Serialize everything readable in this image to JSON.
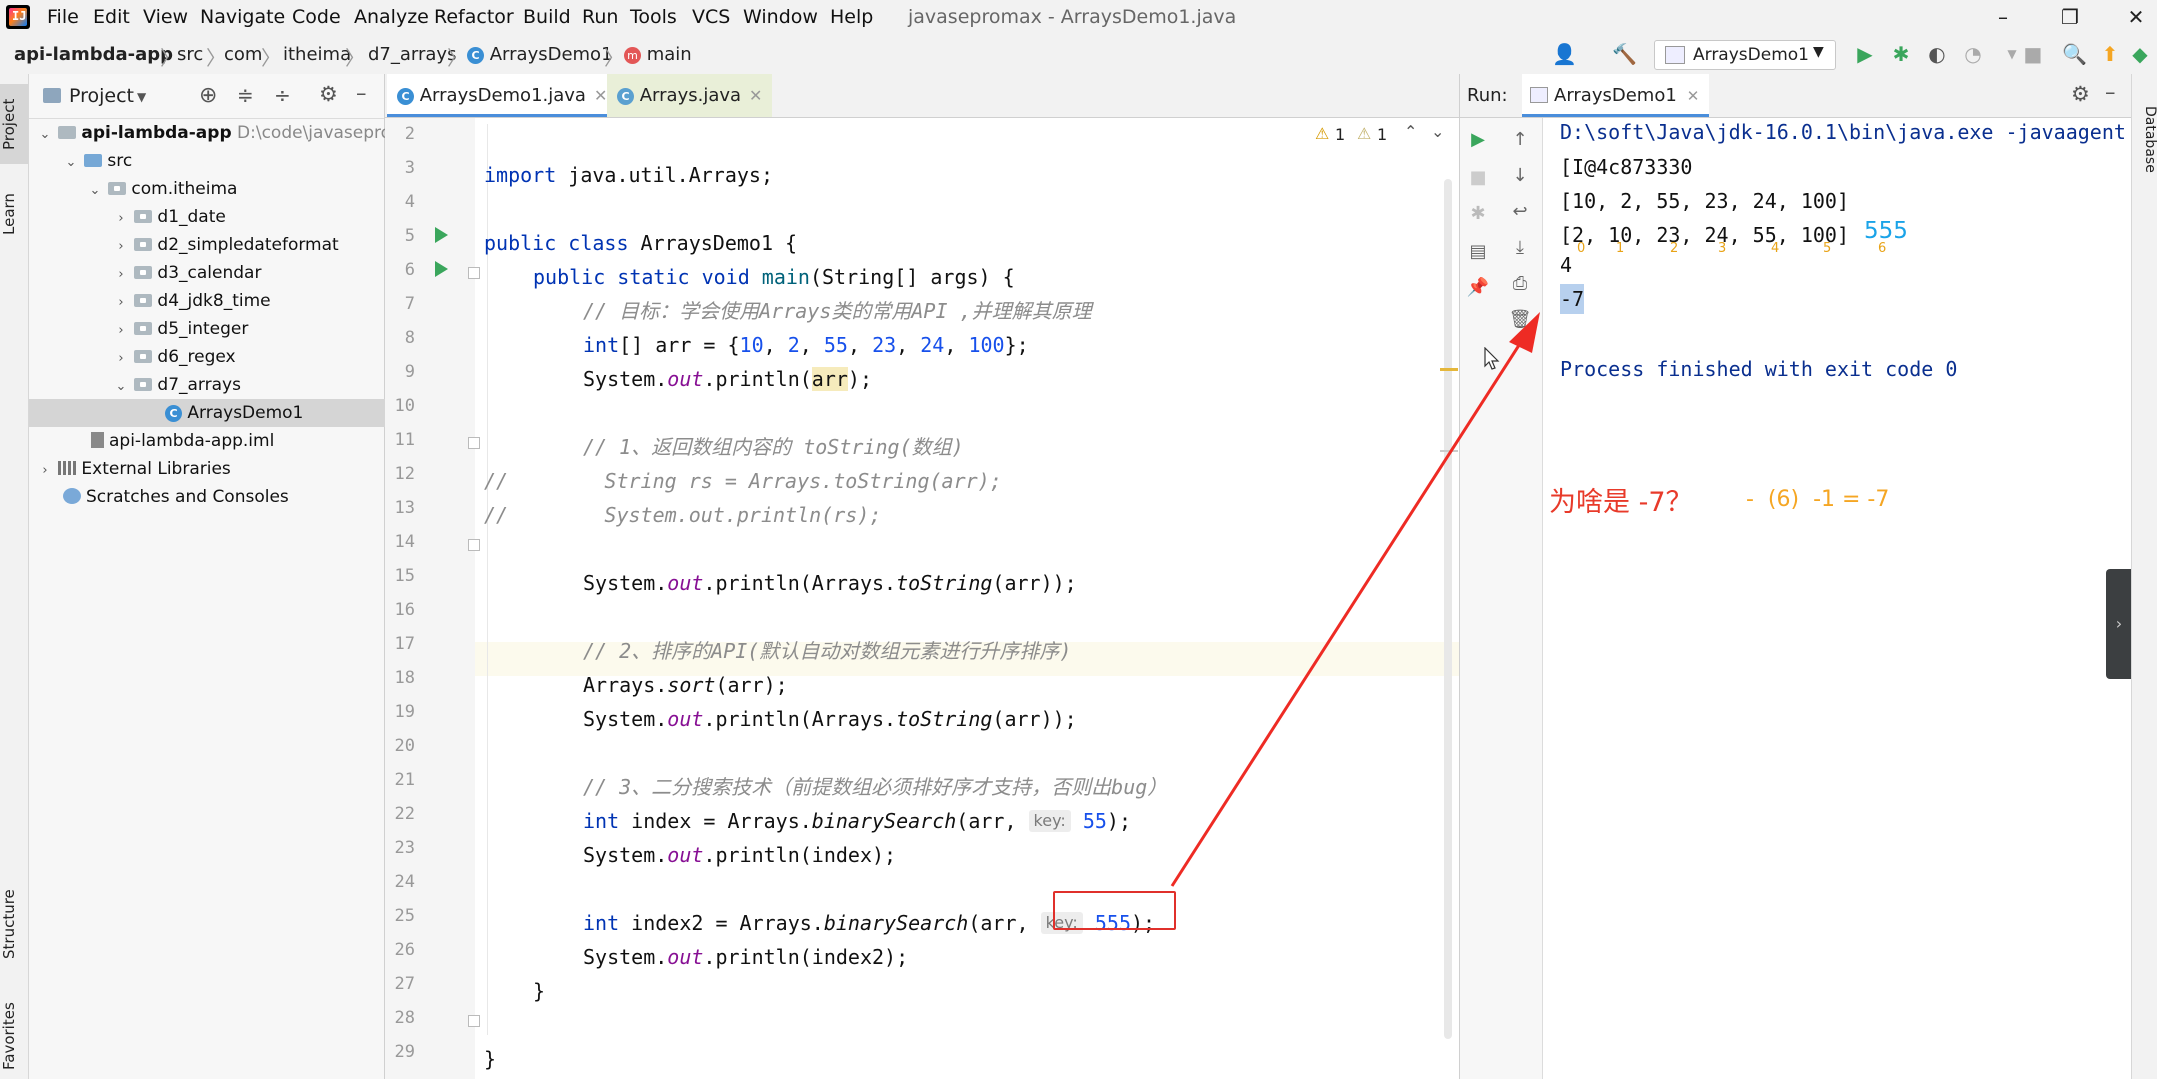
{
  "menubar": {
    "items": [
      "File",
      "Edit",
      "View",
      "Navigate",
      "Code",
      "Analyze",
      "Refactor",
      "Build",
      "Run",
      "Tools",
      "VCS",
      "Window",
      "Help"
    ],
    "window_title": "javasepromax - ArraysDemo1.java"
  },
  "navbar": {
    "breadcrumbs": [
      "api-lambda-app",
      "src",
      "com",
      "itheima",
      "d7_arrays",
      "ArraysDemo1",
      "main"
    ],
    "run_config": "ArraysDemo1"
  },
  "left_strip": {
    "tabs": [
      "Project",
      "Learn",
      "Structure",
      "Favorites"
    ]
  },
  "right_strip": {
    "tabs": [
      "Database"
    ]
  },
  "project": {
    "title": "Project",
    "tree": [
      {
        "label": "api-lambda-app",
        "extra": "D:\\code\\javasepro",
        "kind": "module",
        "arrow": "v"
      },
      {
        "label": "src",
        "kind": "folder-blue",
        "arrow": "v"
      },
      {
        "label": "com.itheima",
        "kind": "package",
        "arrow": "v"
      },
      {
        "label": "d1_date",
        "kind": "package",
        "arrow": ">"
      },
      {
        "label": "d2_simpledateformat",
        "kind": "package",
        "arrow": ">"
      },
      {
        "label": "d3_calendar",
        "kind": "package",
        "arrow": ">"
      },
      {
        "label": "d4_jdk8_time",
        "kind": "package",
        "arrow": ">"
      },
      {
        "label": "d5_integer",
        "kind": "package",
        "arrow": ">"
      },
      {
        "label": "d6_regex",
        "kind": "package",
        "arrow": ">"
      },
      {
        "label": "d7_arrays",
        "kind": "package",
        "arrow": "v"
      },
      {
        "label": "ArraysDemo1",
        "kind": "class",
        "arrow": ""
      },
      {
        "label": "api-lambda-app.iml",
        "kind": "iml",
        "arrow": ""
      },
      {
        "label": "External Libraries",
        "kind": "lib",
        "arrow": ">"
      },
      {
        "label": "Scratches and Consoles",
        "kind": "scratch",
        "arrow": ""
      }
    ]
  },
  "editor": {
    "tabs": [
      {
        "label": "ArraysDemo1.java",
        "active": true
      },
      {
        "label": "Arrays.java",
        "active": false
      }
    ],
    "warnings": [
      "1",
      "1"
    ],
    "line_numbers": [
      "2",
      "3",
      "4",
      "5",
      "6",
      "7",
      "8",
      "9",
      "10",
      "11",
      "12",
      "13",
      "14",
      "15",
      "16",
      "17",
      "18",
      "19",
      "20",
      "21",
      "22",
      "23",
      "24",
      "25",
      "26",
      "27",
      "28",
      "29"
    ],
    "code": {
      "l3_kw": "import",
      "l3_rest": " java.util.Arrays;",
      "l5_kw": "public class",
      "l5_rest": " ArraysDemo1 {",
      "l6_kw": "public static void",
      "l6_fn": "main",
      "l6_rest": "(String[] args) {",
      "l7": "// 目标：学会使用Arrays类的常用API ,并理解其原理",
      "l8_kw": "int",
      "l8_a": "[] arr = {",
      "l8_n1": "10",
      "l8_c1": ", ",
      "l8_n2": "2",
      "l8_c2": ", ",
      "l8_n3": "55",
      "l8_c3": ", ",
      "l8_n4": "23",
      "l8_c4": ", ",
      "l8_n5": "24",
      "l8_c5": ", ",
      "l8_n6": "100",
      "l8_end": "};",
      "l9_a": "System.",
      "l9_out": "out",
      "l9_b": ".println(",
      "l9_arr": "arr",
      "l9_c": ");",
      "l11": "// 1、返回数组内容的 toString(数组)",
      "l12": "//        String rs = Arrays.toString(arr);",
      "l13": "//        System.out.println(rs);",
      "l15_a": "System.",
      "l15_out": "out",
      "l15_b": ".println(Arrays.",
      "l15_fn": "toString",
      "l15_c": "(arr));",
      "l17": "// 2、排序的API(默认自动对数组元素进行升序排序)",
      "l18_a": "Arrays.",
      "l18_fn": "sort",
      "l18_b": "(arr);",
      "l19_a": "System.",
      "l19_out": "out",
      "l19_b": ".println(Arrays.",
      "l19_fn": "toString",
      "l19_c": "(arr));",
      "l21": "// 3、二分搜索技术（前提数组必须排好序才支持，否则出bug）",
      "l22_kw": "int",
      "l22_a": " index = Arrays.",
      "l22_fn": "binarySearch",
      "l22_b": "(arr, ",
      "l22_hint": "key:",
      "l22_num": "55",
      "l22_c": ");",
      "l23_a": "System.",
      "l23_out": "out",
      "l23_b": ".println(index);",
      "l25_kw": "int",
      "l25_a": " index2 = Arrays.",
      "l25_fn": "binarySearch",
      "l25_b": "(arr, ",
      "l25_hint": "key:",
      "l25_num": "555",
      "l25_c": ");",
      "l26_a": "System.",
      "l26_out": "out",
      "l26_b": ".println(index2);",
      "l27": "}",
      "l29": "}"
    }
  },
  "run": {
    "label": "Run:",
    "tab": "ArraysDemo1",
    "output": [
      "D:\\soft\\Java\\jdk-16.0.1\\bin\\java.exe -javaagent",
      "[I@4c873330",
      "[10, 2, 55, 23, 24, 100]",
      "[2, 10, 23, 24, 55, 100]",
      "4",
      "-7",
      "Process finished with exit code 0"
    ],
    "annotation_555": "555",
    "index_marks": [
      "0",
      "1",
      "2",
      "3",
      "4",
      "5",
      "6"
    ],
    "question": "为啥是 -7？",
    "answer": "-  (6)  -1 = -7",
    "colors": {
      "annotation_blue": "#1aa3e8",
      "question_red": "#e83a2a",
      "answer_orange": "#f5a623",
      "arrow_red": "#ee2b24"
    }
  }
}
